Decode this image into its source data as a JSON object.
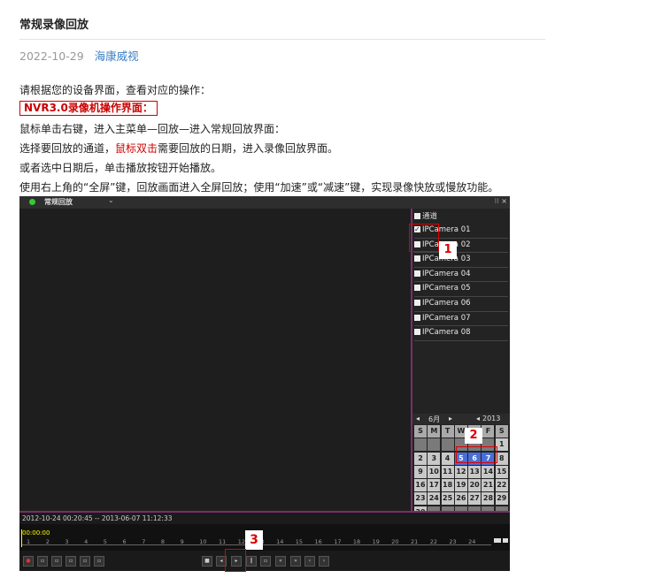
{
  "article": {
    "title": "常规录像回放",
    "date": "2022-10-29",
    "author": "海康威视",
    "intro": " 请根据您的设备界面，查看对应的操作：",
    "section_label": "NVR3.0录像机操作界面：",
    "step1": "鼠标单击右键，进入主菜单—回放—进入常规回放界面：",
    "step2_a": "选择要回放的通道，",
    "step2_hl": "鼠标双击",
    "step2_b": "需要回放的日期，进入录像回放界面。",
    "step3": "或者选中日期后，单击播放按钮开始播放。",
    "step4": "使用右上角的“全屏”键，回放画面进入全屏回放；使用“加速”或“减速”键，实现录像快放或慢放功能。"
  },
  "dvr": {
    "window_title": "常规回放",
    "title_arrow": "⌄",
    "win_buttons": "⁝⁝ ×",
    "channel_header": "通道",
    "channels": [
      {
        "label": "IPCamera 01",
        "checked": true
      },
      {
        "label": "IPCamera 02",
        "checked": false
      },
      {
        "label": "IPCamera 03",
        "checked": false
      },
      {
        "label": "IPCamera 04",
        "checked": false
      },
      {
        "label": "IPCamera 05",
        "checked": false
      },
      {
        "label": "IPCamera 06",
        "checked": false
      },
      {
        "label": "IPCamera 07",
        "checked": false
      },
      {
        "label": "IPCamera 08",
        "checked": false
      }
    ],
    "calendar": {
      "prev": "◂",
      "month": "6月",
      "next": "▸",
      "year_prev": "◂",
      "year": "2013",
      "year_next": "▸",
      "weekdays": [
        "S",
        "M",
        "T",
        "W",
        "T",
        "F",
        "S"
      ],
      "weeks": [
        [
          "",
          "",
          "",
          "",
          "",
          "",
          "1"
        ],
        [
          "2",
          "3",
          "4",
          "5",
          "6",
          "7",
          "8"
        ],
        [
          "9",
          "10",
          "11",
          "12",
          "13",
          "14",
          "15"
        ],
        [
          "16",
          "17",
          "18",
          "19",
          "20",
          "21",
          "22"
        ],
        [
          "23",
          "24",
          "25",
          "26",
          "27",
          "28",
          "29"
        ],
        [
          "30",
          "",
          "",
          "",
          "",
          "",
          ""
        ]
      ],
      "selected": [
        "5",
        "6",
        "7"
      ]
    },
    "time_range": "2012-10-24 00:20:45 -- 2013-06-07 11:12:33",
    "timeline_start": "00:00:00",
    "ticks": [
      "1",
      "2",
      "3",
      "4",
      "5",
      "6",
      "7",
      "8",
      "9",
      "10",
      "11",
      "12",
      "13",
      "14",
      "15",
      "16",
      "17",
      "18",
      "19",
      "20",
      "21",
      "22",
      "23",
      "24"
    ],
    "markers": [
      "1",
      "2",
      "3"
    ]
  }
}
